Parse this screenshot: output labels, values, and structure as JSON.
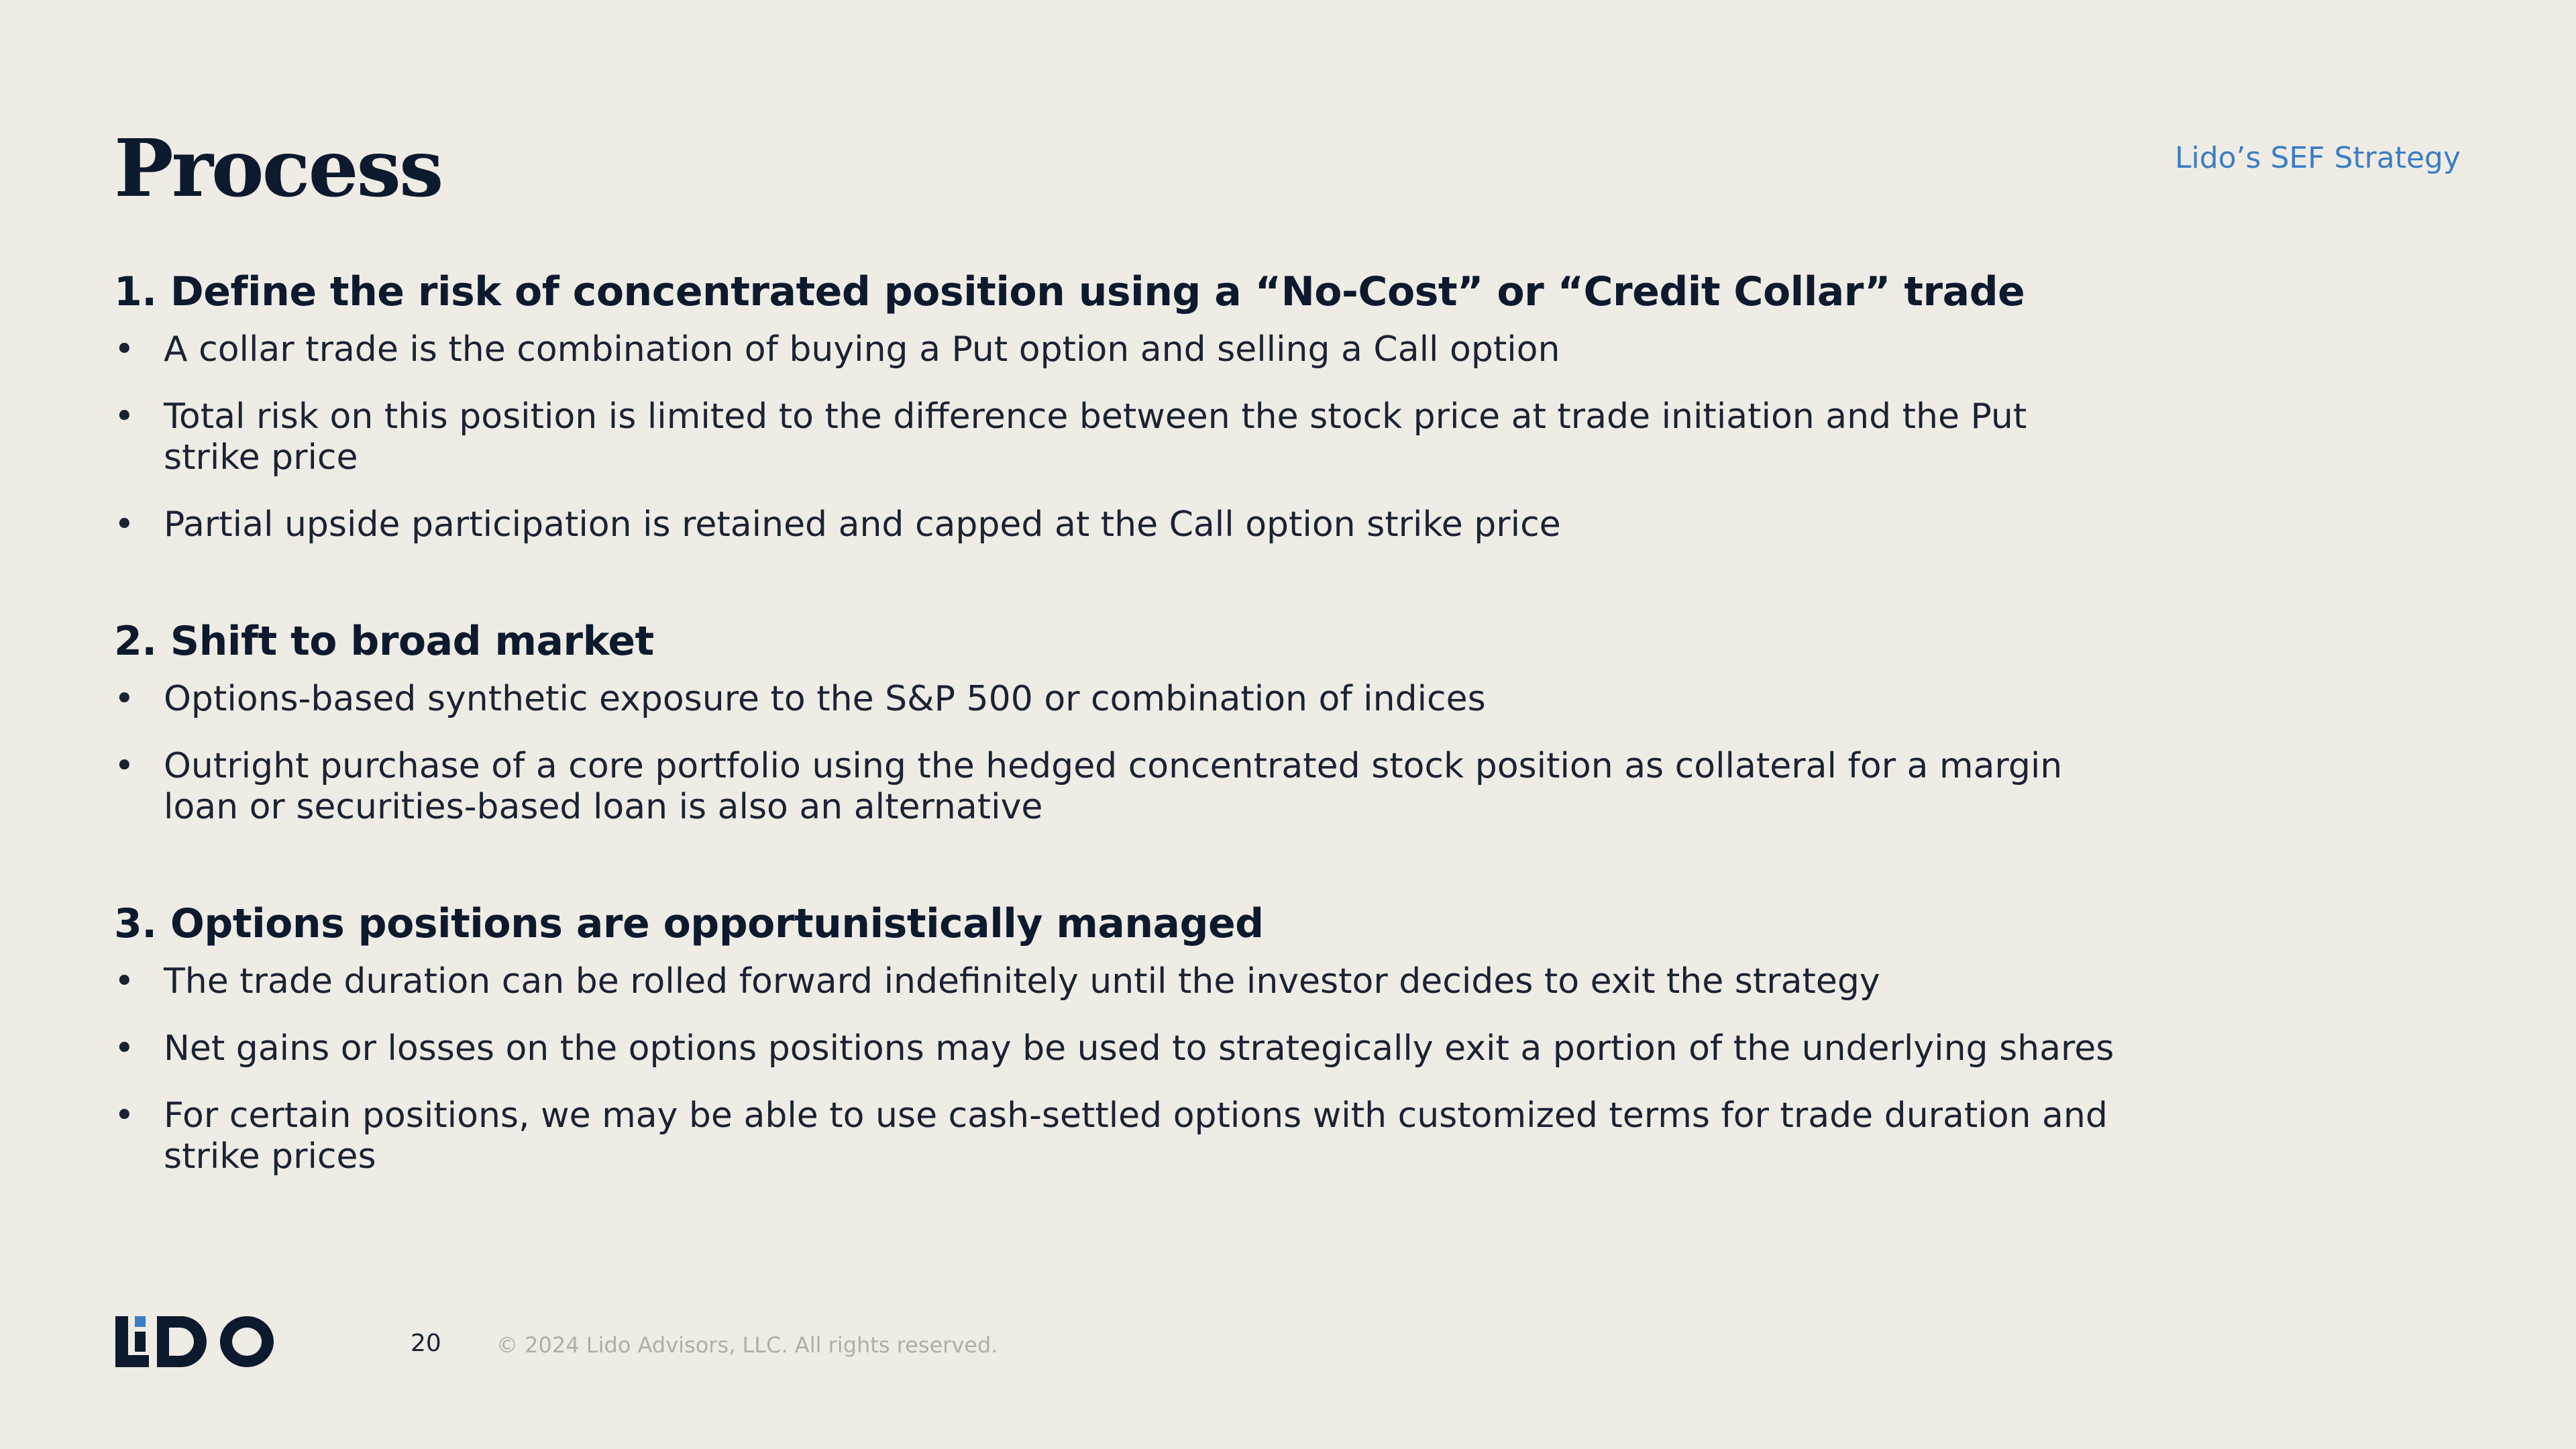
{
  "slide": {
    "title": "Process",
    "tag": "Lido’s SEF Strategy",
    "page_number": "20",
    "copyright": "© 2024 Lido Advisors, LLC. All rights reserved.",
    "logo_text": "LiDO"
  },
  "sections": [
    {
      "heading": "1. Define the risk of concentrated position using a “No-Cost” or “Credit Collar” trade",
      "bullets": [
        "A collar trade is the combination of buying a Put option and selling a Call option",
        "Total risk on this position is limited to the difference between the stock price at trade initiation and the Put strike price",
        "Partial upside participation is retained and capped at the Call option strike price"
      ]
    },
    {
      "heading": "2. Shift to broad market",
      "bullets": [
        "Options-based synthetic exposure to the S&P 500 or combination of indices",
        "Outright purchase of a core portfolio using the hedged concentrated stock position as collateral for a margin loan or securities-based loan is also an alternative"
      ]
    },
    {
      "heading": "3. Options positions are opportunistically managed",
      "bullets": [
        "The trade duration can be rolled forward indefinitely until the investor decides to exit the strategy",
        "Net gains or losses on the options positions may be used to strategically exit a portion of the underlying shares",
        "For certain positions, we may be able to use cash-settled options with customized terms for trade duration and strike prices"
      ]
    }
  ],
  "colors": {
    "background": "#efece5",
    "navy": "#0d1a2e",
    "accent_blue": "#3b7dc4",
    "muted_gray": "#b1aea7"
  }
}
